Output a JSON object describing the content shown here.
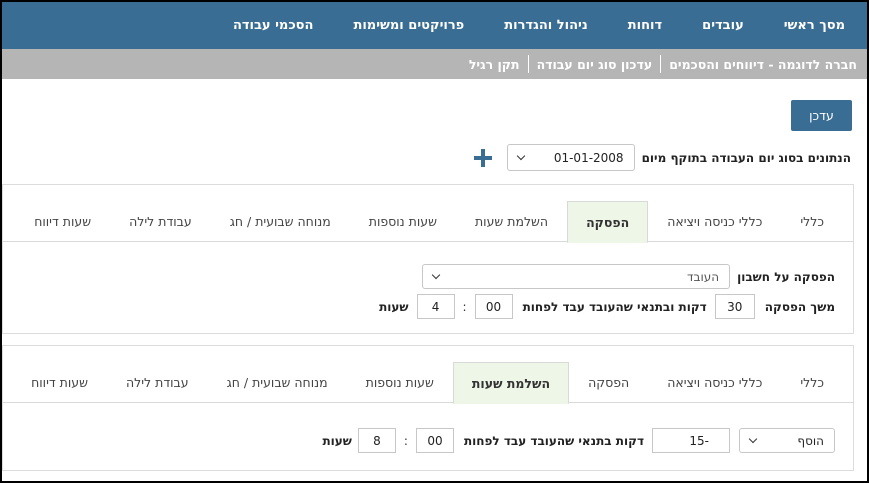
{
  "nav": {
    "items": [
      "מסך ראשי",
      "עובדים",
      "דוחות",
      "ניהול והגדרות",
      "פרויקטים ומשימות",
      "הסכמי עבודה"
    ]
  },
  "breadcrumb": {
    "items": [
      "חברה לדוגמה - דיווחים והסכמים",
      "עדכון סוג יום עבודה",
      "תקן רגיל"
    ]
  },
  "toolbar": {
    "update_label": "עדכן"
  },
  "effective": {
    "label": "הנתונים בסוג יום העבודה בתוקף מיום",
    "date_value": "01-01-2008",
    "add_icon": "plus-icon"
  },
  "tabs": [
    "כללי",
    "כללי כניסה ויציאה",
    "הפסקה",
    "השלמת שעות",
    "שעות נוספות",
    "מנוחה שבועית / חג",
    "עבודת לילה",
    "שעות דיווח"
  ],
  "panel1": {
    "active_tab": 2,
    "break_account_label": "הפסקה על חשבון",
    "break_account_value": "העובד",
    "duration_label": "משך הפסקה",
    "duration_minutes": "30",
    "condition_label": "דקות ובתנאי שהעובד עבד לפחות",
    "minutes_value": "00",
    "hours_value": "4",
    "hours_label": "שעות",
    "colon": ":"
  },
  "panel2": {
    "active_tab": 3,
    "mode_value": "הוסף",
    "minutes_amount": "-15",
    "condition_label": "דקות בתנאי שהעובד עבד לפחות",
    "minutes_value": "00",
    "hours_value": "8",
    "hours_label": "שעות",
    "colon": ":"
  }
}
